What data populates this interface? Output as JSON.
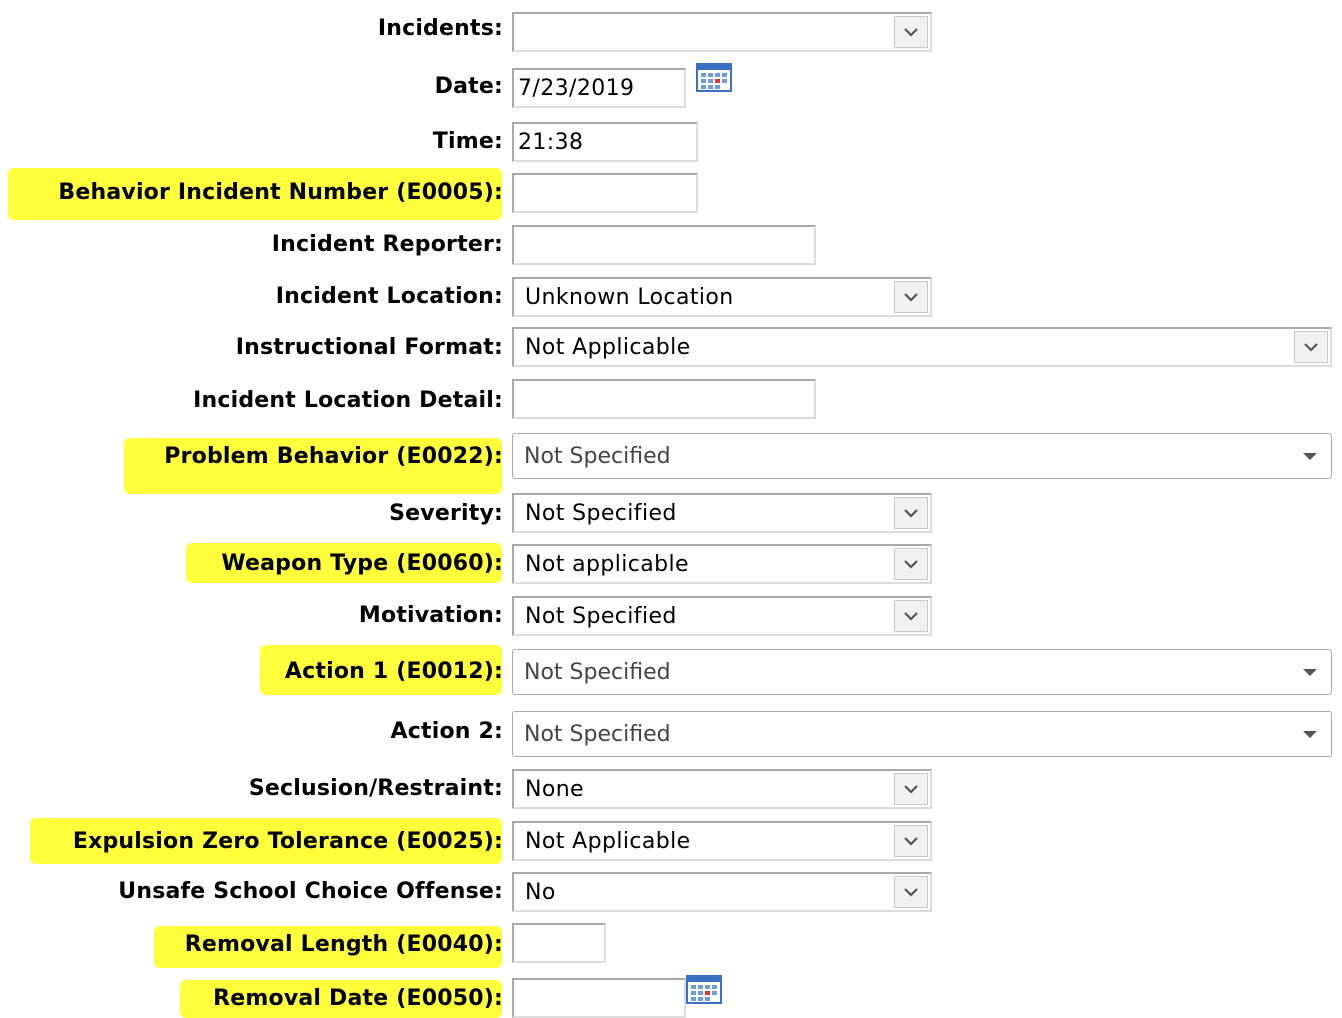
{
  "fields": {
    "incidents": {
      "label": "Incidents:",
      "value": ""
    },
    "date": {
      "label": "Date:",
      "value": "7/23/2019"
    },
    "time": {
      "label": "Time:",
      "value": "21:38"
    },
    "behavior_incident_number": {
      "label": "Behavior Incident Number (E0005):",
      "value": ""
    },
    "incident_reporter": {
      "label": "Incident Reporter:",
      "value": ""
    },
    "incident_location": {
      "label": "Incident Location:",
      "value": "Unknown Location"
    },
    "instructional_format": {
      "label": "Instructional Format:",
      "value": "Not Applicable"
    },
    "incident_location_detail": {
      "label": "Incident Location Detail:",
      "value": ""
    },
    "problem_behavior": {
      "label": "Problem Behavior (E0022):",
      "value": "Not Specified"
    },
    "severity": {
      "label": "Severity:",
      "value": "Not Specified"
    },
    "weapon_type": {
      "label": "Weapon Type (E0060):",
      "value": "Not applicable"
    },
    "motivation": {
      "label": "Motivation:",
      "value": "Not Specified"
    },
    "action_1": {
      "label": "Action 1 (E0012):",
      "value": "Not Specified"
    },
    "action_2": {
      "label": "Action 2:",
      "value": "Not Specified"
    },
    "seclusion_restraint": {
      "label": "Seclusion/Restraint:",
      "value": "None"
    },
    "expulsion_zero_tolerance": {
      "label": "Expulsion Zero Tolerance (E0025):",
      "value": "Not Applicable"
    },
    "unsafe_school_choice_offense": {
      "label": "Unsafe School Choice Offense:",
      "value": "No"
    },
    "removal_length": {
      "label": "Removal Length (E0040):",
      "value": ""
    },
    "removal_date": {
      "label": "Removal Date (E0050):",
      "value": ""
    }
  },
  "colors": {
    "highlight": "#ffff3c",
    "input_border": "#a9a9a9",
    "dropdown_button_bg": "#f1f1f1",
    "calendar_icon": "#3a6fc4"
  },
  "icons": {
    "dropdown": "chevron-down-icon",
    "searchable_dropdown": "caret-down-icon",
    "date_picker": "calendar-icon"
  }
}
